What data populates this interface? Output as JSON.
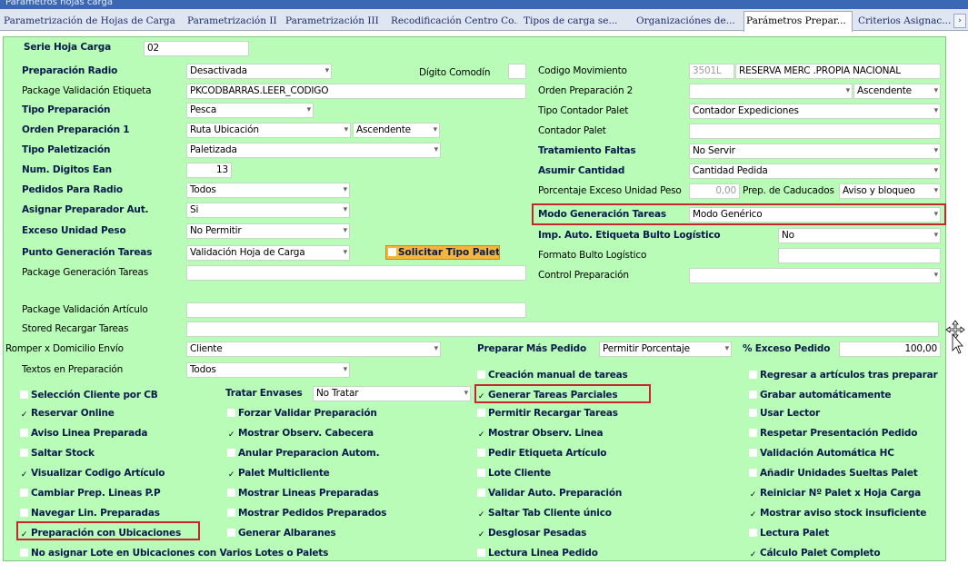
{
  "window": {
    "title": "Parametros hojas carga"
  },
  "tabs": [
    "Parametrización de Hojas de Carga",
    "Parametrización II",
    "Parametrización III",
    "Recodificación Centro Co...",
    "Tipos de carga se...",
    "Organizaciónes de...",
    "Parámetros Prepar...",
    "Criterios Asignac..."
  ],
  "tab_scroll": "›",
  "header": {
    "serie_label": "Serie Hoja Carga",
    "serie_value": "02"
  },
  "left": {
    "preparacion_radio": {
      "label": "Preparación Radio",
      "value": "Desactivada"
    },
    "package_validacion_etiqueta": {
      "label": "Package Validación Etiqueta",
      "value": "PKCODBARRAS.LEER_CODIGO"
    },
    "tipo_preparacion": {
      "label": "Tipo Preparación",
      "value": "Pesca"
    },
    "orden_preparacion_1": {
      "label": "Orden Preparación 1",
      "value": "Ruta Ubicación",
      "order": "Ascendente"
    },
    "tipo_paletizacion": {
      "label": "Tipo Paletización",
      "value": "Paletizada"
    },
    "num_digitos_ean": {
      "label": "Num. Digitos Ean",
      "value": "13"
    },
    "pedidos_para_radio": {
      "label": "Pedidos Para Radio",
      "value": "Todos"
    },
    "asignar_preparador": {
      "label": "Asignar Preparador Aut.",
      "value": "Si"
    },
    "exceso_unidad_peso": {
      "label": "Exceso Unidad Peso",
      "value": "No Permitir"
    },
    "punto_generacion_tareas": {
      "label": "Punto Generación Tareas",
      "value": "Validación Hoja de Carga"
    },
    "solicitar_tipo_palet": "Solicitar Tipo Palet",
    "package_generacion_tareas": {
      "label": "Package Generación Tareas",
      "value": ""
    },
    "package_validacion_articulo": {
      "label": "Package Validación Artículo",
      "value": ""
    },
    "stored_recargar_tareas": {
      "label": "Stored Recargar Tareas",
      "value": ""
    },
    "romper_domicilio": {
      "label": "Romper x Domicilio Envío",
      "value": "Cliente"
    },
    "textos_preparacion": {
      "label": "Textos en Preparación",
      "value": "Todos"
    }
  },
  "middle": {
    "digito_comodin": {
      "label": "Dígito Comodín",
      "value": ""
    }
  },
  "right": {
    "codigo_movimiento": {
      "label": "Codigo Movimiento",
      "code": "3501L",
      "value": "RESERVA MERC .PROPIA NACIONAL"
    },
    "orden_preparacion_2": {
      "label": "Orden Preparación 2",
      "value": "",
      "order": "Ascendente"
    },
    "tipo_contador_palet": {
      "label": "Tipo Contador Palet",
      "value": "Contador Expediciones"
    },
    "contador_palet": {
      "label": "Contador Palet",
      "value": ""
    },
    "tratamiento_faltas": {
      "label": "Tratamiento Faltas",
      "value": "No Servir"
    },
    "asumir_cantidad": {
      "label": "Asumir Cantidad",
      "value": "Cantidad Pedida"
    },
    "porcentaje_exceso": {
      "label": "Porcentaje Exceso Unidad Peso",
      "value": "0,00",
      "caducados_label": "Prep. de Caducados",
      "caducados_value": "Aviso y bloqueo"
    },
    "modo_generacion_tareas": {
      "label": "Modo Generación Tareas",
      "value": "Modo Genérico"
    },
    "imp_auto_etiqueta": {
      "label": "Imp. Auto. Etiqueta Bulto Logístico",
      "value": "No"
    },
    "formato_bulto": {
      "label": "Formato Bulto Logístico",
      "value": ""
    },
    "control_preparacion": {
      "label": "Control Preparación",
      "value": ""
    },
    "preparar_mas_pedido": {
      "label": "Preparar Más Pedido",
      "value": "Permitir Porcentaje"
    },
    "exceso_pedido": {
      "label": "% Exceso Pedido",
      "value": "100,00"
    }
  },
  "tratar_envases": {
    "label": "Tratar Envases",
    "value": "No Tratar"
  },
  "checkboxes": {
    "col1": [
      {
        "label": "Selección Cliente por CB",
        "checked": false
      },
      {
        "label": "Reservar Online",
        "checked": true
      },
      {
        "label": "Aviso Linea Preparada",
        "checked": false
      },
      {
        "label": "Saltar Stock",
        "checked": false
      },
      {
        "label": "Visualizar Codigo Artículo",
        "checked": true
      },
      {
        "label": "Cambiar Prep. Lineas P.P",
        "checked": false
      },
      {
        "label": "Navegar Lin. Preparadas",
        "checked": false
      },
      {
        "label": "Preparación con Ubicaciones",
        "checked": true
      },
      {
        "label": "No asignar Lote en Ubicaciones con Varios Lotes o Palets",
        "checked": false
      }
    ],
    "col2": [
      {
        "label": "Forzar Validar Preparación",
        "checked": false
      },
      {
        "label": "Mostrar Observ. Cabecera",
        "checked": true
      },
      {
        "label": "Anular Preparacion Autom.",
        "checked": false
      },
      {
        "label": "Palet Multicliente",
        "checked": true
      },
      {
        "label": "Mostrar Lineas Preparadas",
        "checked": false
      },
      {
        "label": "Mostrar Pedidos Preparados",
        "checked": false
      },
      {
        "label": "Generar Albaranes",
        "checked": false
      }
    ],
    "col3": [
      {
        "label": "Creación manual de tareas",
        "checked": false
      },
      {
        "label": "Generar Tareas Parciales",
        "checked": true
      },
      {
        "label": "Permitir Recargar Tareas",
        "checked": false
      },
      {
        "label": "Mostrar Observ. Linea",
        "checked": true
      },
      {
        "label": "Pedir Etiqueta Artículo",
        "checked": false
      },
      {
        "label": "Lote Cliente",
        "checked": false
      },
      {
        "label": "Validar Auto. Preparación",
        "checked": false
      },
      {
        "label": "Saltar Tab Cliente único",
        "checked": true
      },
      {
        "label": "Desglosar Pesadas",
        "checked": true
      },
      {
        "label": "Lectura Linea Pedido",
        "checked": false
      }
    ],
    "col4": [
      {
        "label": "Regresar a artículos tras preparar",
        "checked": false
      },
      {
        "label": "Grabar automáticamente",
        "checked": false
      },
      {
        "label": "Usar Lector",
        "checked": false
      },
      {
        "label": "Respetar Presentación Pedido",
        "checked": false
      },
      {
        "label": "Validación Automática HC",
        "checked": false
      },
      {
        "label": "Añadir Unidades Sueltas Palet",
        "checked": false
      },
      {
        "label": "Reiniciar Nº Palet x Hoja Carga",
        "checked": true
      },
      {
        "label": "Mostrar aviso stock insuficiente",
        "checked": true
      },
      {
        "label": "Lectura Palet",
        "checked": false
      },
      {
        "label": "Cálculo Palet Completo",
        "checked": true
      }
    ]
  },
  "colors": {
    "panel": "#b8fcb8",
    "highlight": "#c8262f",
    "button": "#f4b53b",
    "label": "#0a1b4a"
  },
  "icons": {
    "checkmark": "✓",
    "cursor": "move-cursor-icon"
  }
}
